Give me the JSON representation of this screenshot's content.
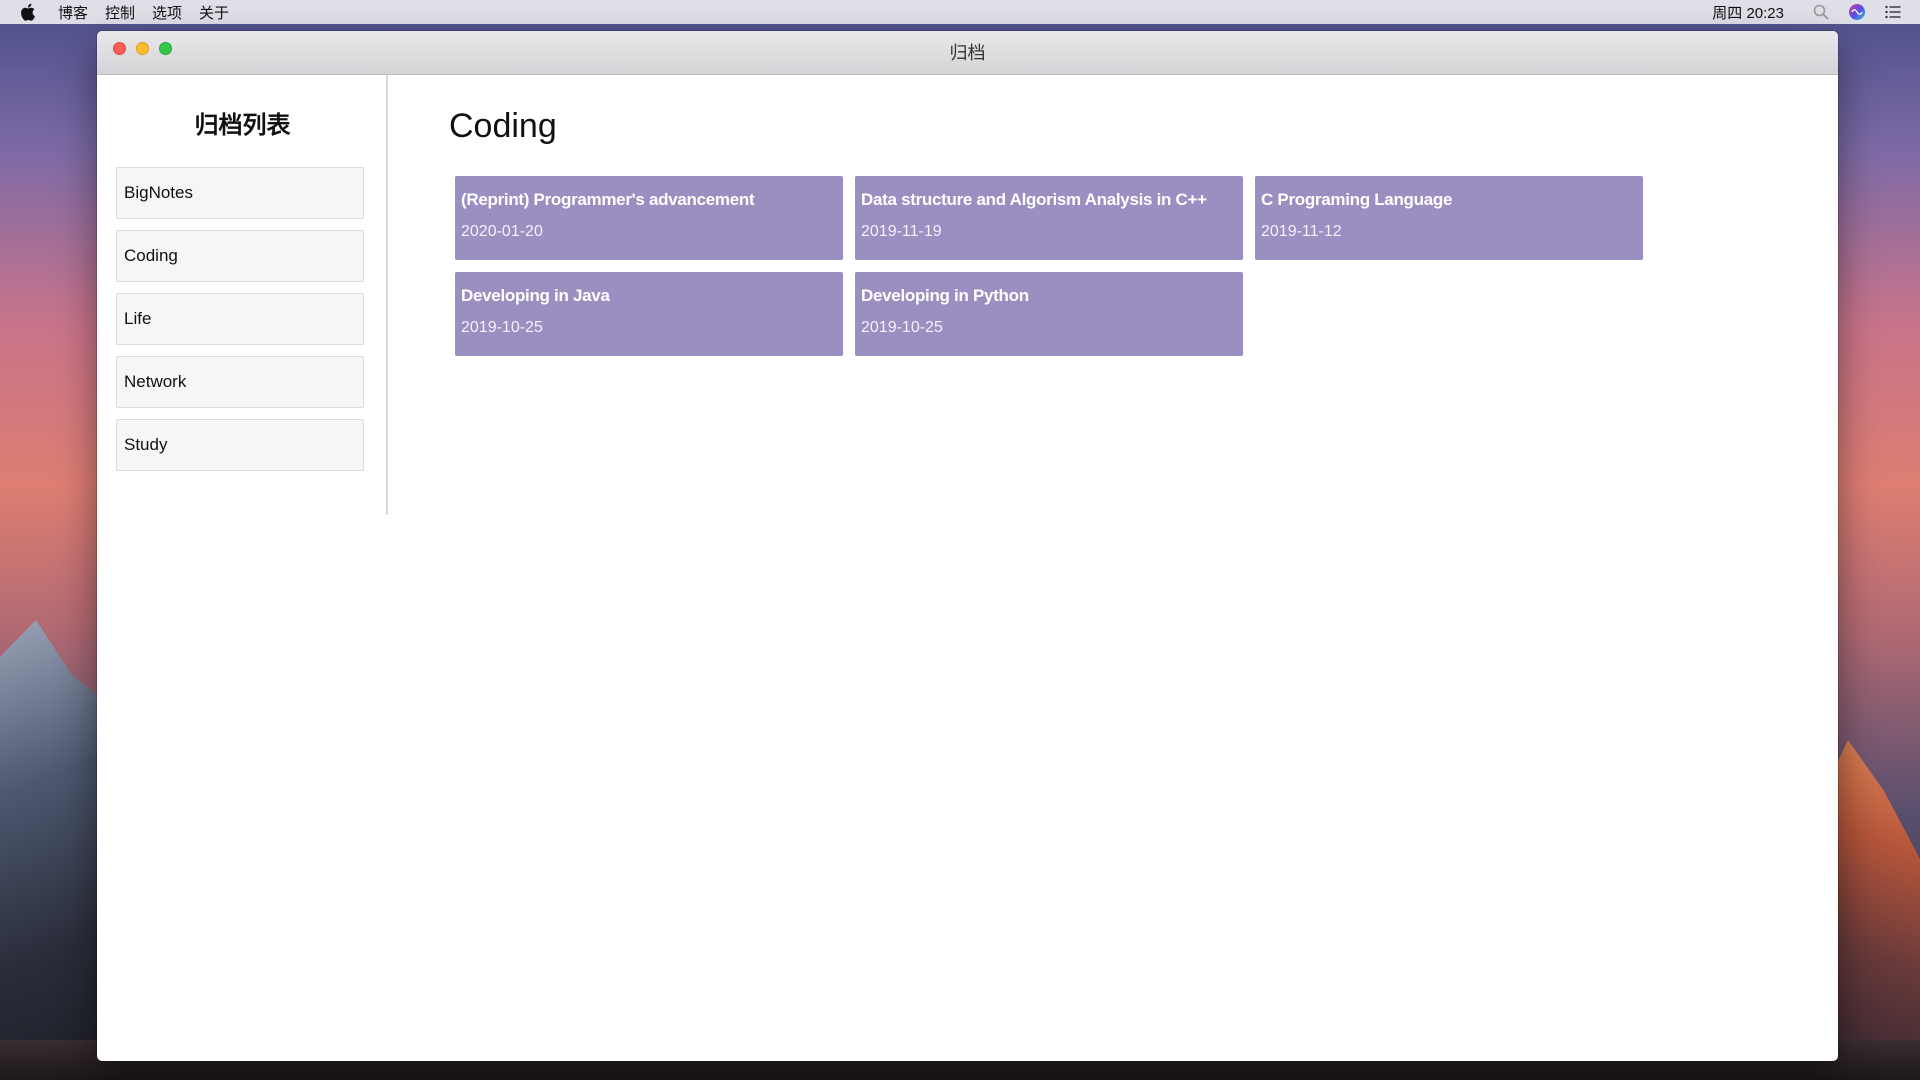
{
  "menubar": {
    "items": [
      "博客",
      "控制",
      "选项",
      "关于"
    ],
    "clock": "周四 20:23",
    "icons": [
      "apple-icon",
      "search-icon",
      "siri-icon",
      "notification-list-icon"
    ]
  },
  "window": {
    "title": "归档"
  },
  "sidebar": {
    "title": "归档列表",
    "items": [
      {
        "label": "BigNotes"
      },
      {
        "label": "Coding"
      },
      {
        "label": "Life"
      },
      {
        "label": "Network"
      },
      {
        "label": "Study"
      }
    ]
  },
  "main": {
    "title": "Coding",
    "cards": [
      {
        "title": "(Reprint) Programmer's advancement",
        "date": "2020-01-20"
      },
      {
        "title": "Data structure and Algorism Analysis in C++",
        "date": "2019-11-19"
      },
      {
        "title": "C Programing Language",
        "date": "2019-11-12"
      },
      {
        "title": "Developing in Java",
        "date": "2019-10-25"
      },
      {
        "title": "Developing in Python",
        "date": "2019-10-25"
      }
    ]
  },
  "colors": {
    "card_bg": "#9b8fc2",
    "close": "#fc5f57",
    "minimize": "#fdbc2e",
    "maximize": "#33c748"
  }
}
